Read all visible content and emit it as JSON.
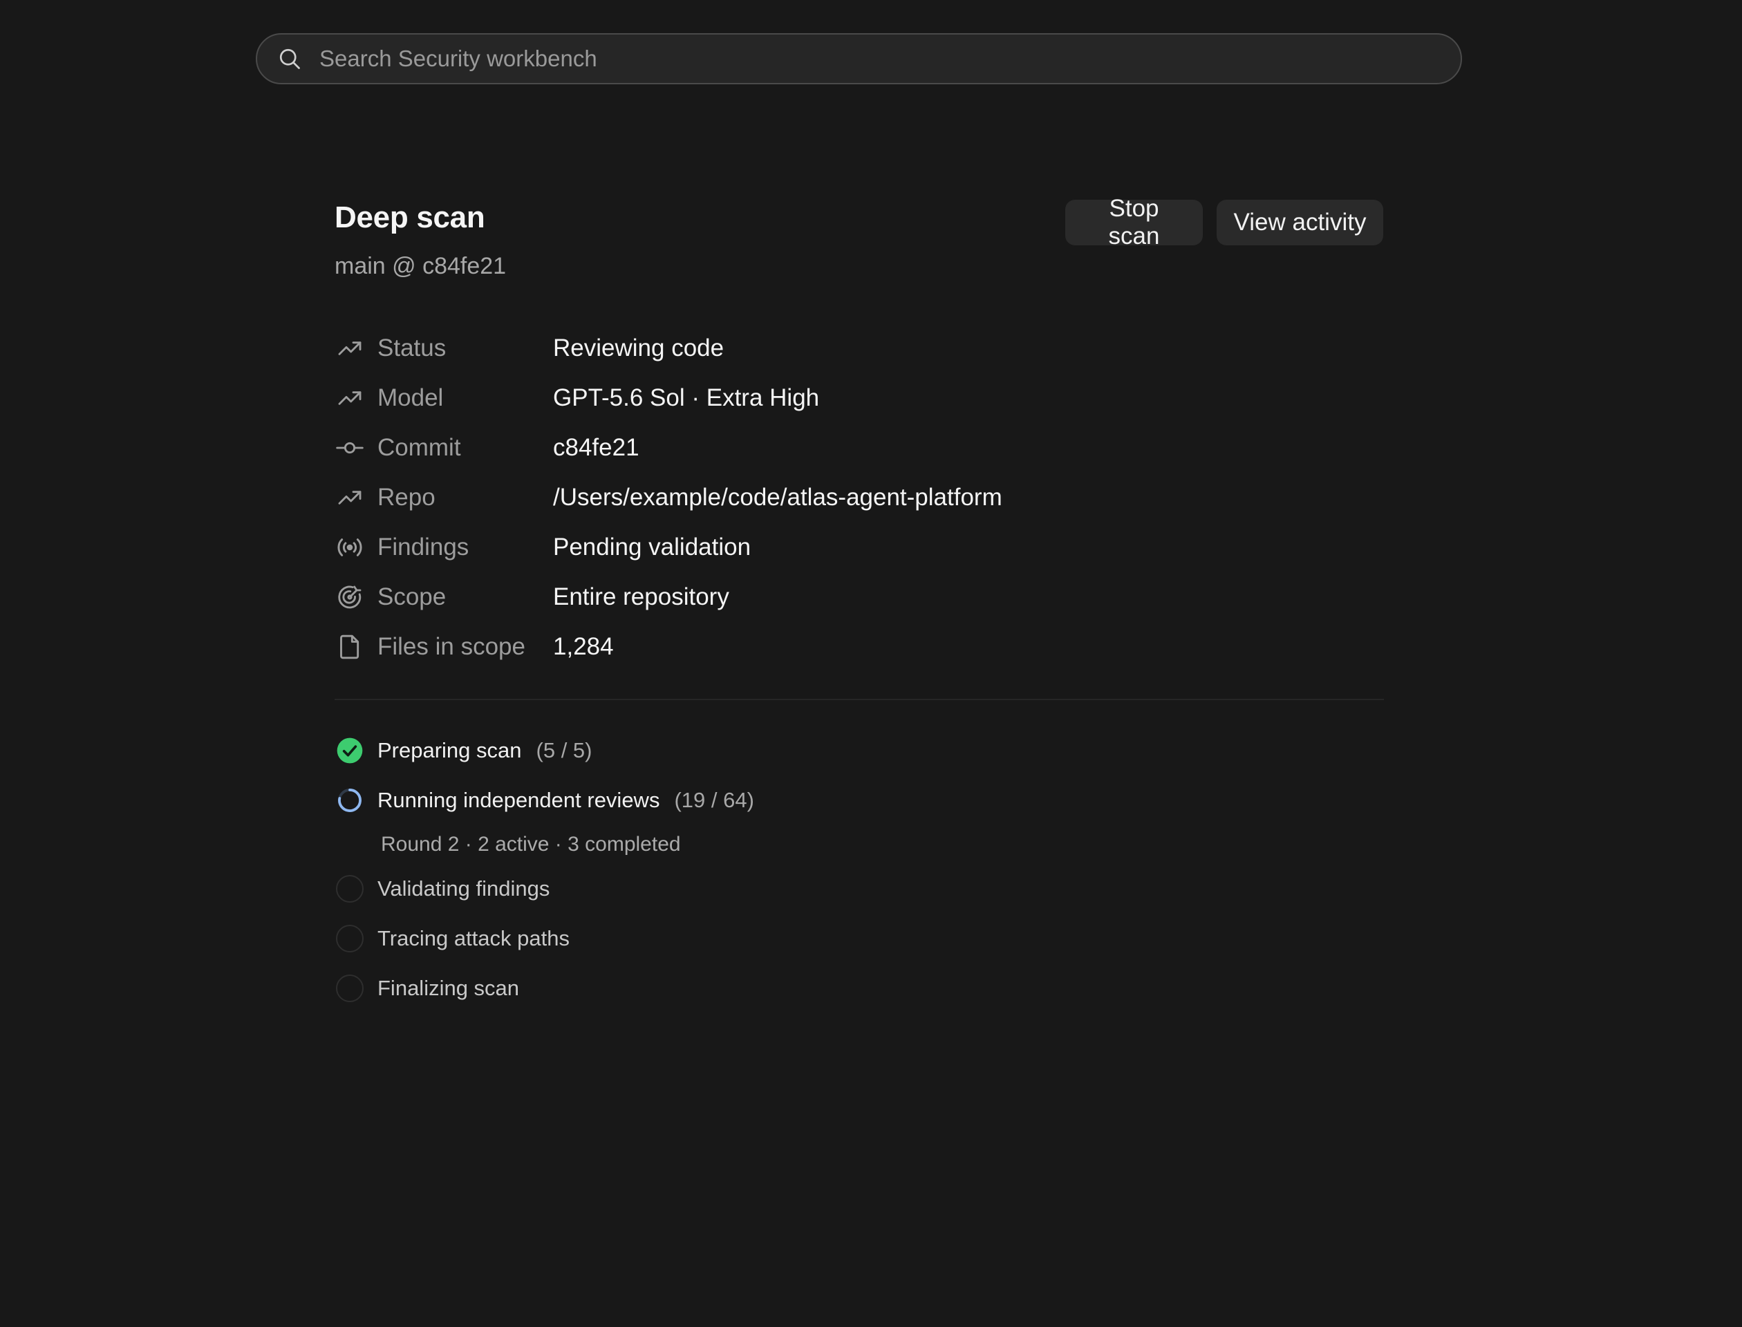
{
  "search": {
    "placeholder": "Search Security workbench",
    "icon": "search-icon"
  },
  "header": {
    "title": "Deep scan",
    "subtitle": "main @ c84fe21",
    "stop_label": "Stop scan",
    "activity_label": "View activity"
  },
  "details": [
    {
      "icon": "trending-up-icon",
      "label": "Status",
      "value": "Reviewing code"
    },
    {
      "icon": "trending-up-icon",
      "label": "Model",
      "value": "GPT-5.6 Sol · Extra High"
    },
    {
      "icon": "git-commit-icon",
      "label": "Commit",
      "value": "c84fe21"
    },
    {
      "icon": "trending-up-icon",
      "label": "Repo",
      "value": "/Users/example/code/atlas-agent-platform"
    },
    {
      "icon": "broadcast-icon",
      "label": "Findings",
      "value": "Pending validation"
    },
    {
      "icon": "target-icon",
      "label": "Scope",
      "value": "Entire repository"
    },
    {
      "icon": "file-icon",
      "label": "Files in scope",
      "value": "1,284"
    }
  ],
  "steps": [
    {
      "label": "Preparing scan",
      "count": "(5 / 5)",
      "state": "complete",
      "progress": 1.0
    },
    {
      "label": "Running independent reviews",
      "count": "(19 / 64)",
      "state": "running",
      "progress": 0.2969,
      "detail": "Round 2 · 2 active · 3 completed"
    },
    {
      "label": "Validating findings",
      "state": "pending"
    },
    {
      "label": "Tracing attack paths",
      "state": "pending"
    },
    {
      "label": "Finalizing scan",
      "state": "pending"
    }
  ],
  "colors": {
    "background": "#181818",
    "success": "#3dcc6f",
    "running": "#8fb8f0",
    "muted": "#9d9d9d"
  }
}
